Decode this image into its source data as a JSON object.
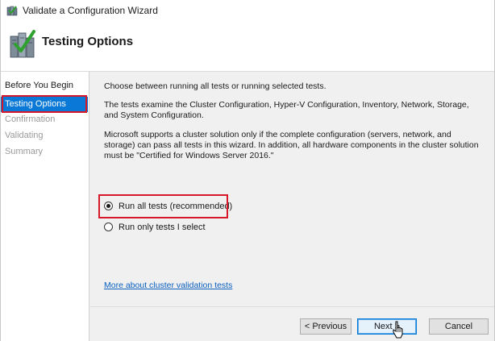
{
  "window": {
    "title": "Validate a Configuration Wizard"
  },
  "header": {
    "title": "Testing Options"
  },
  "nav": {
    "items": [
      {
        "label": "Before You Begin",
        "state": "normal"
      },
      {
        "label": "Testing Options",
        "state": "active"
      },
      {
        "label": "Confirmation",
        "state": "disabled"
      },
      {
        "label": "Validating",
        "state": "disabled"
      },
      {
        "label": "Summary",
        "state": "disabled"
      }
    ]
  },
  "content": {
    "intro": "Choose between running all tests or running selected tests.",
    "description": "The tests examine the Cluster Configuration, Hyper-V Configuration, Inventory, Network, Storage, and System Configuration.",
    "support_note": "Microsoft supports a cluster solution only if the complete configuration (servers, network, and storage) can pass all tests in this wizard. In addition, all hardware components in the cluster solution must be \"Certified for Windows Server 2016.\"",
    "options": [
      {
        "label": "Run all tests (recommended)",
        "selected": true
      },
      {
        "label": "Run only tests I select",
        "selected": false
      }
    ],
    "help_link": "More about cluster validation tests"
  },
  "footer": {
    "previous_label": "< Previous",
    "next_label": "Next >",
    "cancel_label": "Cancel"
  },
  "colors": {
    "accent": "#0a78d7",
    "highlight_box": "#d7182a",
    "link": "#0a5fbf"
  }
}
